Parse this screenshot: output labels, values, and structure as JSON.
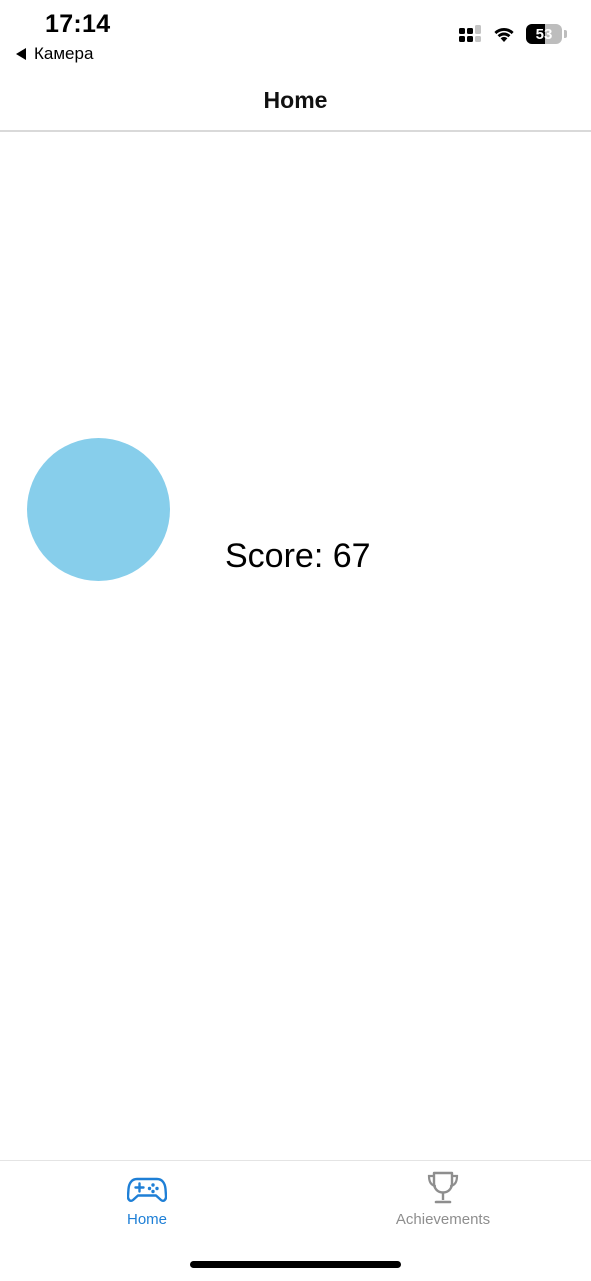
{
  "status_bar": {
    "time": "17:14",
    "back_label": "Камера",
    "battery_level": 53,
    "battery_text": "53",
    "icons": [
      "signal-icon",
      "wifi-icon",
      "battery-icon"
    ]
  },
  "header": {
    "title": "Home"
  },
  "game": {
    "circle_color": "#87CEEB",
    "score_text": "Score: 67"
  },
  "tab_bar": {
    "active_color": "#1E7FD6",
    "inactive_color": "#8E8E8E",
    "tabs": [
      {
        "label": "Home",
        "icon": "gamepad-icon",
        "active": true
      },
      {
        "label": "Achievements",
        "icon": "trophy-icon",
        "active": false
      }
    ]
  }
}
